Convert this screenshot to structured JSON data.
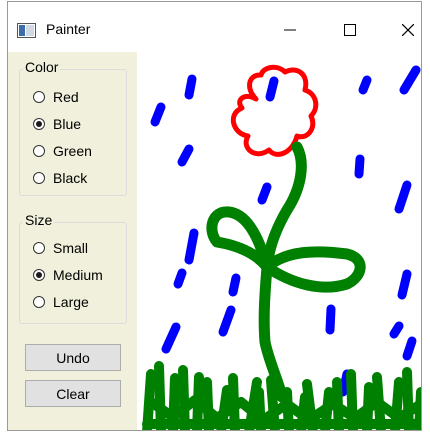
{
  "window": {
    "title": "Painter",
    "controls": {
      "minimize": "—",
      "maximize": "☐",
      "close": "✕"
    }
  },
  "color_group": {
    "label": "Color",
    "options": [
      "Red",
      "Blue",
      "Green",
      "Black"
    ],
    "selected": "Blue"
  },
  "size_group": {
    "label": "Size",
    "options": [
      "Small",
      "Medium",
      "Large"
    ],
    "selected": "Medium"
  },
  "buttons": {
    "undo": "Undo",
    "clear": "Clear"
  },
  "drawing": {
    "colors": {
      "red": "#ff0000",
      "blue": "#0000ff",
      "green": "#008000"
    },
    "panel_background": "#f0f0dc"
  }
}
